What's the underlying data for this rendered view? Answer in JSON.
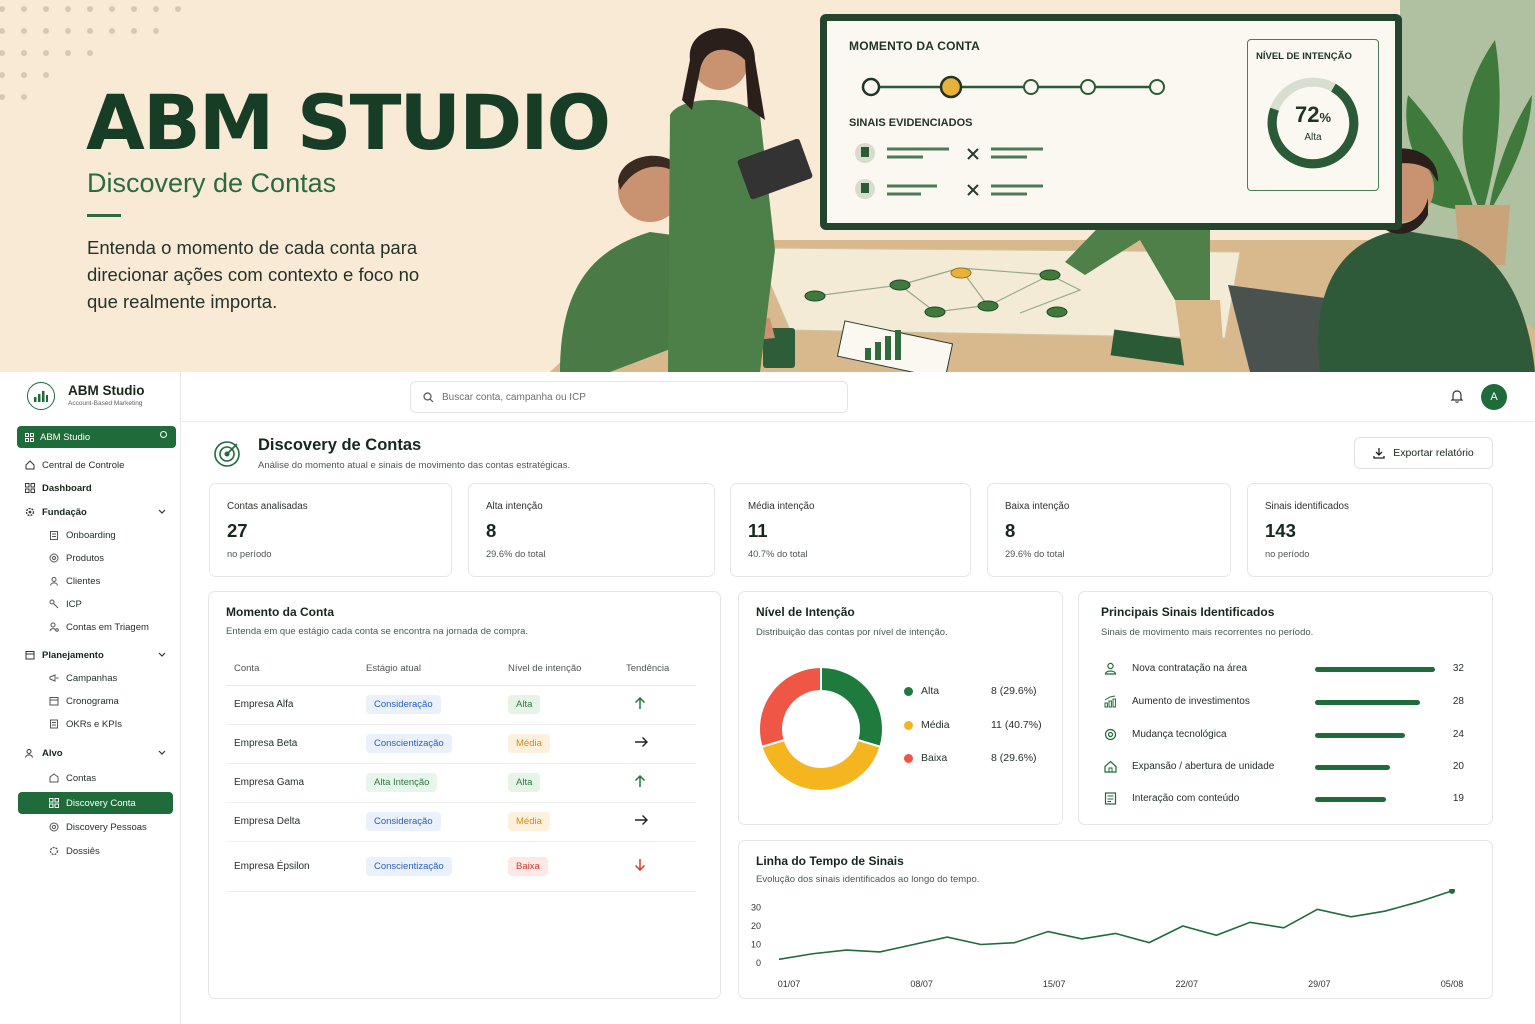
{
  "hero": {
    "title": "ABM STUDIO",
    "subtitle": "Discovery de Contas",
    "description": "Entenda o momento de cada conta para direcionar ações com contexto e foco no que realmente importa.",
    "board_momento": "MOMENTO DA CONTA",
    "board_sinais": "SINAIS EVIDENCIADOS",
    "board_intencao": "NÍVEL DE INTENÇÃO",
    "board_pct": "72",
    "board_pct_unit": "%",
    "board_level": "Alta"
  },
  "brand": {
    "name": "ABM Studio",
    "tagline": "Account-Based Marketing"
  },
  "workspace": {
    "label": "ABM Studio"
  },
  "nav": {
    "central": "Central de Controle",
    "dashboard": "Dashboard",
    "fundacao": "Fundação",
    "onboarding": "Onboarding",
    "produtos": "Produtos",
    "clientes": "Clientes",
    "icp": "ICP",
    "triagem": "Contas em Triagem",
    "planejamento": "Planejamento",
    "campanhas": "Campanhas",
    "cronograma": "Cronograma",
    "okrs": "OKRs e KPIs",
    "alvo": "Alvo",
    "contas": "Contas",
    "discovery_conta": "Discovery Conta",
    "discovery_pessoas": "Discovery Pessoas",
    "dossies": "Dossiês"
  },
  "search": {
    "placeholder": "Buscar conta, campanha ou ICP"
  },
  "user": {
    "initial": "A"
  },
  "page": {
    "title": "Discovery de Contas",
    "subtitle": "Análise do momento atual e sinais de movimento das contas estratégicas.",
    "export_label": "Exportar relatório"
  },
  "kpis": [
    {
      "label": "Contas analisadas",
      "value": "27",
      "foot": "no período"
    },
    {
      "label": "Alta intenção",
      "value": "8",
      "foot": "29.6% do total"
    },
    {
      "label": "Média intenção",
      "value": "11",
      "foot": "40.7% do total"
    },
    {
      "label": "Baixa intenção",
      "value": "8",
      "foot": "29.6% do total"
    },
    {
      "label": "Sinais identificados",
      "value": "143",
      "foot": "no período"
    }
  ],
  "momento": {
    "title": "Momento da Conta",
    "subtitle": "Entenda em que estágio cada conta se encontra na jornada de compra.",
    "columns": [
      "Conta",
      "Estágio atual",
      "Nível de intenção",
      "Tendência"
    ],
    "rows": [
      {
        "conta": "Empresa Alfa",
        "estagio": "Consideração",
        "nivel": "Alta",
        "tendencia": "up"
      },
      {
        "conta": "Empresa Beta",
        "estagio": "Conscientização",
        "nivel": "Média",
        "tendencia": "right"
      },
      {
        "conta": "Empresa Gama",
        "estagio": "Alta Intenção",
        "nivel": "Alta",
        "tendencia": "up"
      },
      {
        "conta": "Empresa Delta",
        "estagio": "Consideração",
        "nivel": "Média",
        "tendencia": "right"
      },
      {
        "conta": "Empresa Épsilon",
        "estagio": "Conscientização",
        "nivel": "Baixa",
        "tendencia": "down"
      }
    ]
  },
  "intencao": {
    "title": "Nível de Intenção",
    "subtitle": "Distribuição das contas por nível de intenção.",
    "legend": [
      {
        "label": "Alta",
        "value": "8 (29.6%)",
        "color": "#1f7a3d"
      },
      {
        "label": "Média",
        "value": "11 (40.7%)",
        "color": "#f5b51f"
      },
      {
        "label": "Baixa",
        "value": "8 (29.6%)",
        "color": "#ef5646"
      }
    ]
  },
  "sinais": {
    "title": "Principais Sinais Identificados",
    "subtitle": "Sinais de movimento mais recorrentes no período.",
    "items": [
      {
        "label": "Nova contratação na área",
        "count": "32",
        "icon": "user-icon"
      },
      {
        "label": "Aumento de investimentos",
        "count": "28",
        "icon": "chart-up-icon"
      },
      {
        "label": "Mudança tecnológica",
        "count": "24",
        "icon": "target-icon"
      },
      {
        "label": "Expansão / abertura de unidade",
        "count": "20",
        "icon": "home-icon"
      },
      {
        "label": "Interação com conteúdo",
        "count": "19",
        "icon": "document-icon"
      }
    ]
  },
  "timeline": {
    "title": "Linha do Tempo de Sinais",
    "subtitle": "Evolução dos sinais identificados ao longo do tempo."
  },
  "chart_data": [
    {
      "type": "pie",
      "categories": [
        "Alta",
        "Média",
        "Baixa"
      ],
      "values": [
        8,
        11,
        8
      ],
      "colors": [
        "#1f7a3d",
        "#f5b51f",
        "#ef5646"
      ]
    },
    {
      "type": "bar",
      "categories": [
        "Nova contratação na área",
        "Aumento de investimentos",
        "Mudança tecnológica",
        "Expansão / abertura de unidade",
        "Interação com conteúdo"
      ],
      "values": [
        32,
        28,
        24,
        20,
        19
      ]
    },
    {
      "type": "line",
      "x_ticks": [
        "01/07",
        "08/07",
        "15/07",
        "22/07",
        "29/07",
        "05/08"
      ],
      "y_ticks": [
        "0",
        "10",
        "20",
        "30"
      ],
      "ylim": [
        0,
        40
      ],
      "grid": false,
      "values": [
        2,
        5,
        7,
        6,
        10,
        14,
        10,
        11,
        17,
        13,
        16,
        11,
        20,
        15,
        22,
        19,
        29,
        25,
        28,
        33,
        39
      ]
    }
  ]
}
